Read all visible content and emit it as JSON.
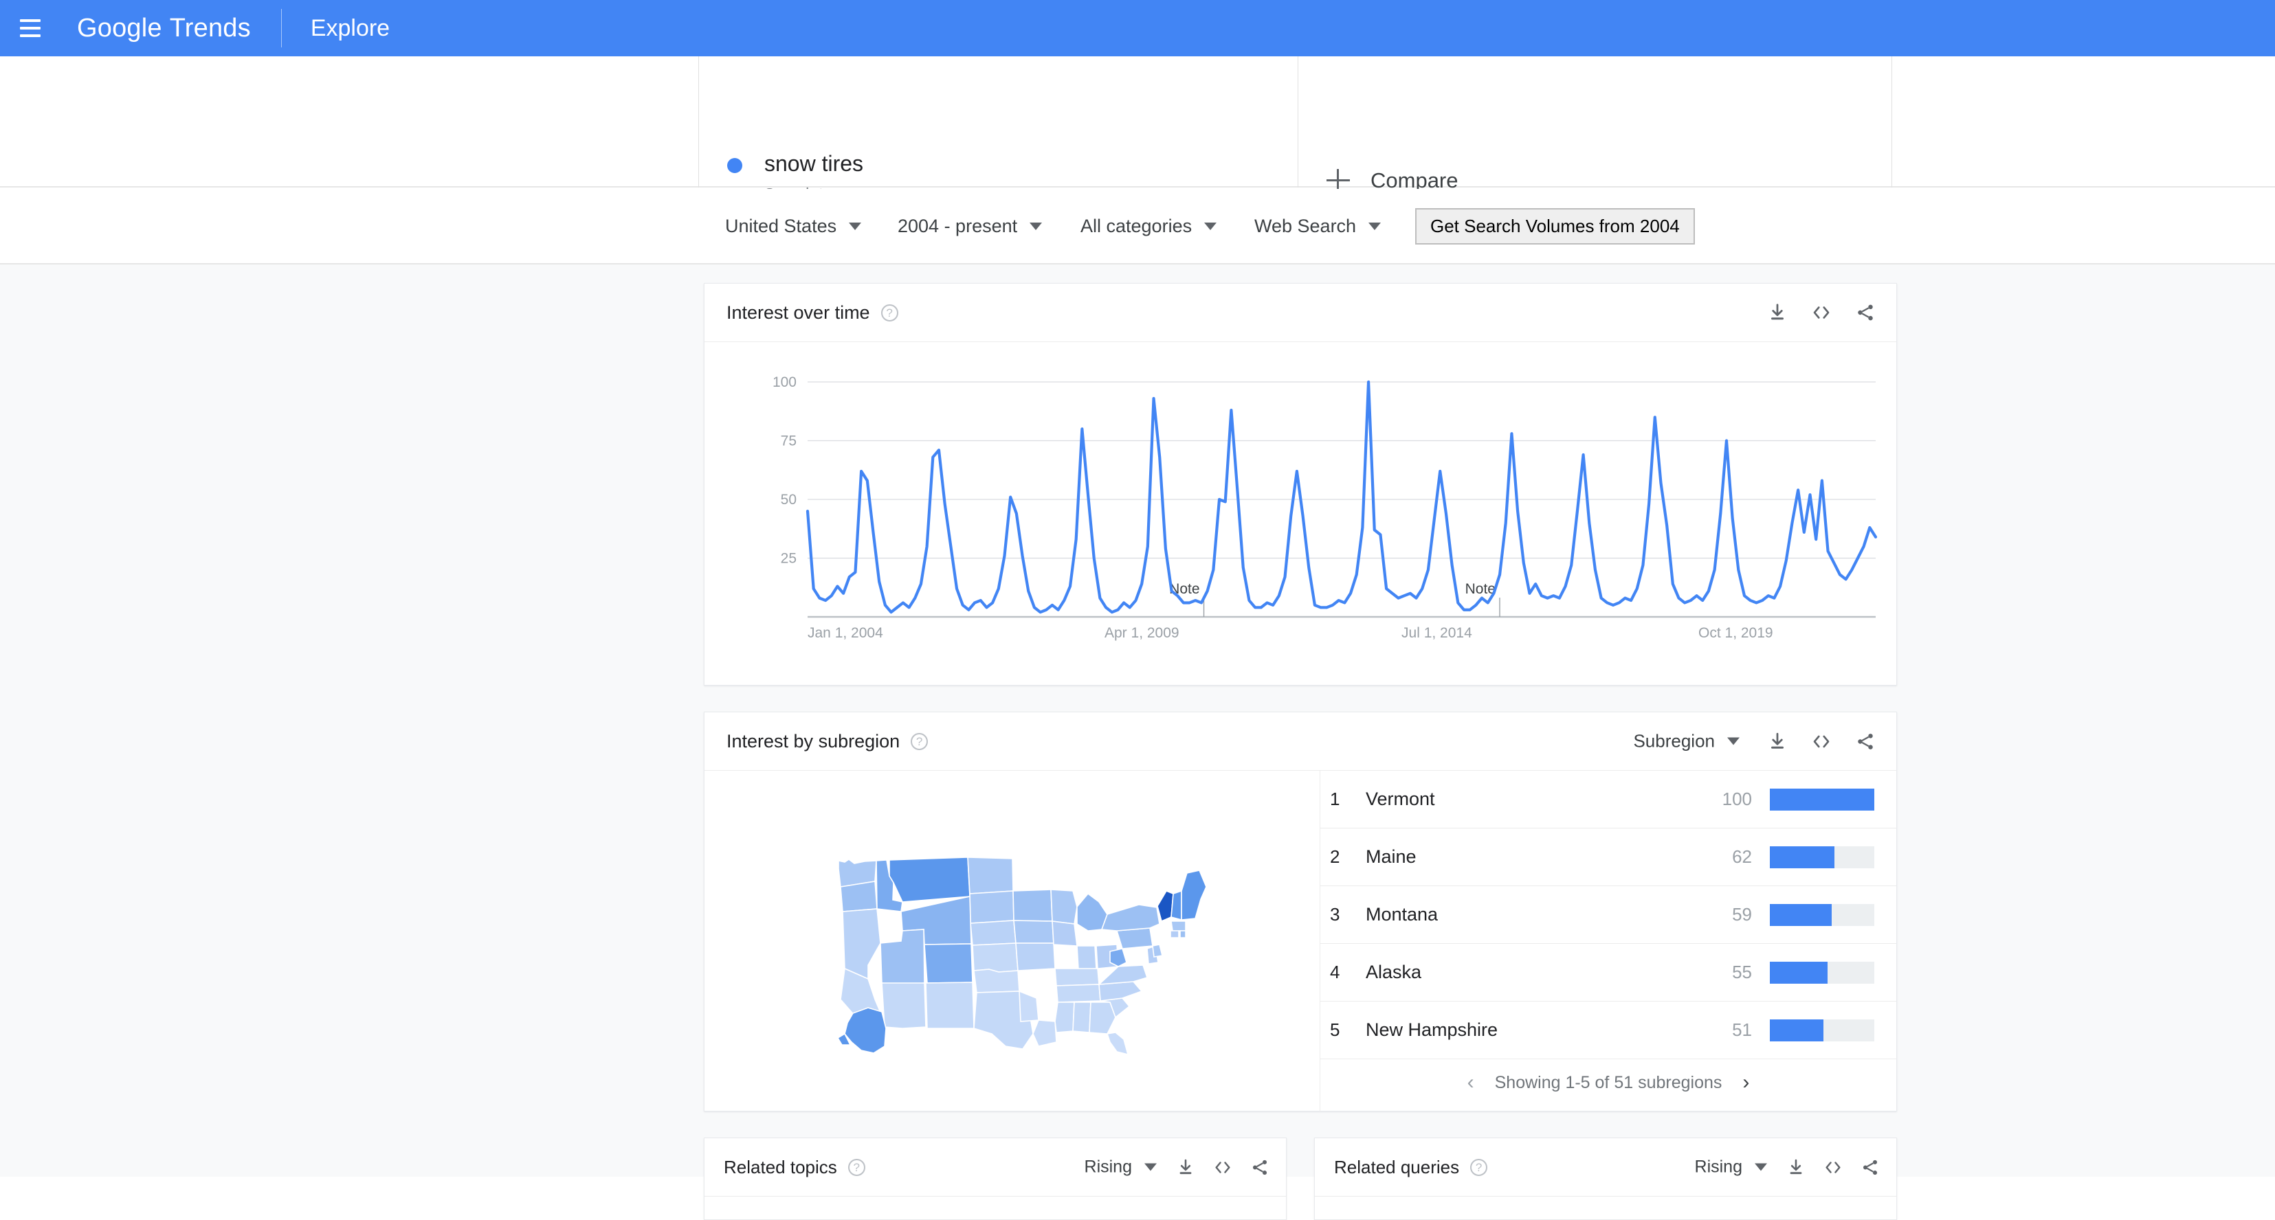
{
  "appbar": {
    "menu_icon": "hamburger-icon",
    "brand_google": "Google",
    "brand_trends": "Trends",
    "explore": "Explore"
  },
  "search_term": {
    "term": "snow tires",
    "type_label": "Search term",
    "dot_color": "#4285f4",
    "compare_label": "Compare"
  },
  "filters": {
    "location": "United States",
    "time_range": "2004 - present",
    "category": "All categories",
    "search_type": "Web Search",
    "volumes_button": "Get Search Volumes from 2004"
  },
  "interest_over_time": {
    "title": "Interest over time",
    "help_icon": "help-icon",
    "download_icon": "download-icon",
    "embed_icon": "embed-icon",
    "share_icon": "share-icon"
  },
  "interest_by_subregion": {
    "title": "Interest by subregion",
    "selector": "Subregion",
    "help_icon": "help-icon",
    "rows": [
      {
        "rank": "1",
        "name": "Vermont",
        "value": "100",
        "pct": 100
      },
      {
        "rank": "2",
        "name": "Maine",
        "value": "62",
        "pct": 62
      },
      {
        "rank": "3",
        "name": "Montana",
        "value": "59",
        "pct": 59
      },
      {
        "rank": "4",
        "name": "Alaska",
        "value": "55",
        "pct": 55
      },
      {
        "rank": "5",
        "name": "New Hampshire",
        "value": "51",
        "pct": 51
      }
    ],
    "pager_text": "Showing 1-5 of 51 subregions",
    "prev_icon": "chevron-left-icon",
    "next_icon": "chevron-right-icon"
  },
  "related_topics": {
    "title": "Related topics",
    "sort": "Rising"
  },
  "related_queries": {
    "title": "Related queries",
    "sort": "Rising"
  },
  "colors": {
    "brand_blue": "#4285f4",
    "page_bg": "#f8f9fa",
    "bar_track": "#eceff1"
  },
  "chart_data": {
    "type": "line",
    "title": "Interest over time",
    "xlabel": "",
    "ylabel": "",
    "ylim": [
      0,
      100
    ],
    "grid": true,
    "legend": [
      "snow tires"
    ],
    "series_color": "#4285f4",
    "xtick_labels": [
      "Jan 1, 2004",
      "Apr 1, 2009",
      "Jul 1, 2014",
      "Oct 1, 2019"
    ],
    "xtick_positions": [
      0.0,
      0.278,
      0.556,
      0.834
    ],
    "ytick_labels": [
      "25",
      "50",
      "75",
      "100"
    ],
    "ytick_values": [
      25,
      50,
      75,
      100
    ],
    "annotations": [
      {
        "label": "Note",
        "x": 0.371
      },
      {
        "label": "Note",
        "x": 0.648
      }
    ],
    "series": [
      {
        "name": "snow tires",
        "values": [
          45,
          12,
          8,
          7,
          9,
          13,
          10,
          17,
          19,
          62,
          58,
          36,
          15,
          5,
          2,
          4,
          6,
          4,
          8,
          14,
          30,
          68,
          71,
          48,
          30,
          12,
          5,
          3,
          6,
          7,
          4,
          6,
          12,
          26,
          51,
          44,
          26,
          11,
          4,
          2,
          3,
          5,
          3,
          7,
          13,
          33,
          80,
          52,
          25,
          8,
          4,
          2,
          3,
          6,
          4,
          7,
          14,
          30,
          93,
          68,
          29,
          11,
          9,
          6,
          6,
          7,
          6,
          11,
          20,
          50,
          49,
          88,
          55,
          21,
          7,
          4,
          4,
          6,
          5,
          9,
          17,
          43,
          62,
          43,
          21,
          5,
          4,
          4,
          5,
          7,
          6,
          10,
          18,
          38,
          100,
          37,
          35,
          12,
          10,
          8,
          9,
          10,
          8,
          12,
          20,
          41,
          62,
          44,
          22,
          6,
          3,
          3,
          5,
          8,
          6,
          10,
          18,
          40,
          78,
          45,
          23,
          10,
          14,
          9,
          8,
          9,
          8,
          13,
          22,
          45,
          69,
          40,
          20,
          8,
          6,
          5,
          6,
          8,
          7,
          12,
          22,
          48,
          85,
          57,
          39,
          14,
          8,
          6,
          7,
          9,
          7,
          11,
          20,
          44,
          75,
          42,
          20,
          9,
          7,
          6,
          7,
          9,
          8,
          13,
          24,
          40,
          54,
          36,
          52,
          33,
          58,
          28,
          23,
          18,
          16,
          20,
          25,
          30,
          38,
          34
        ]
      }
    ]
  }
}
